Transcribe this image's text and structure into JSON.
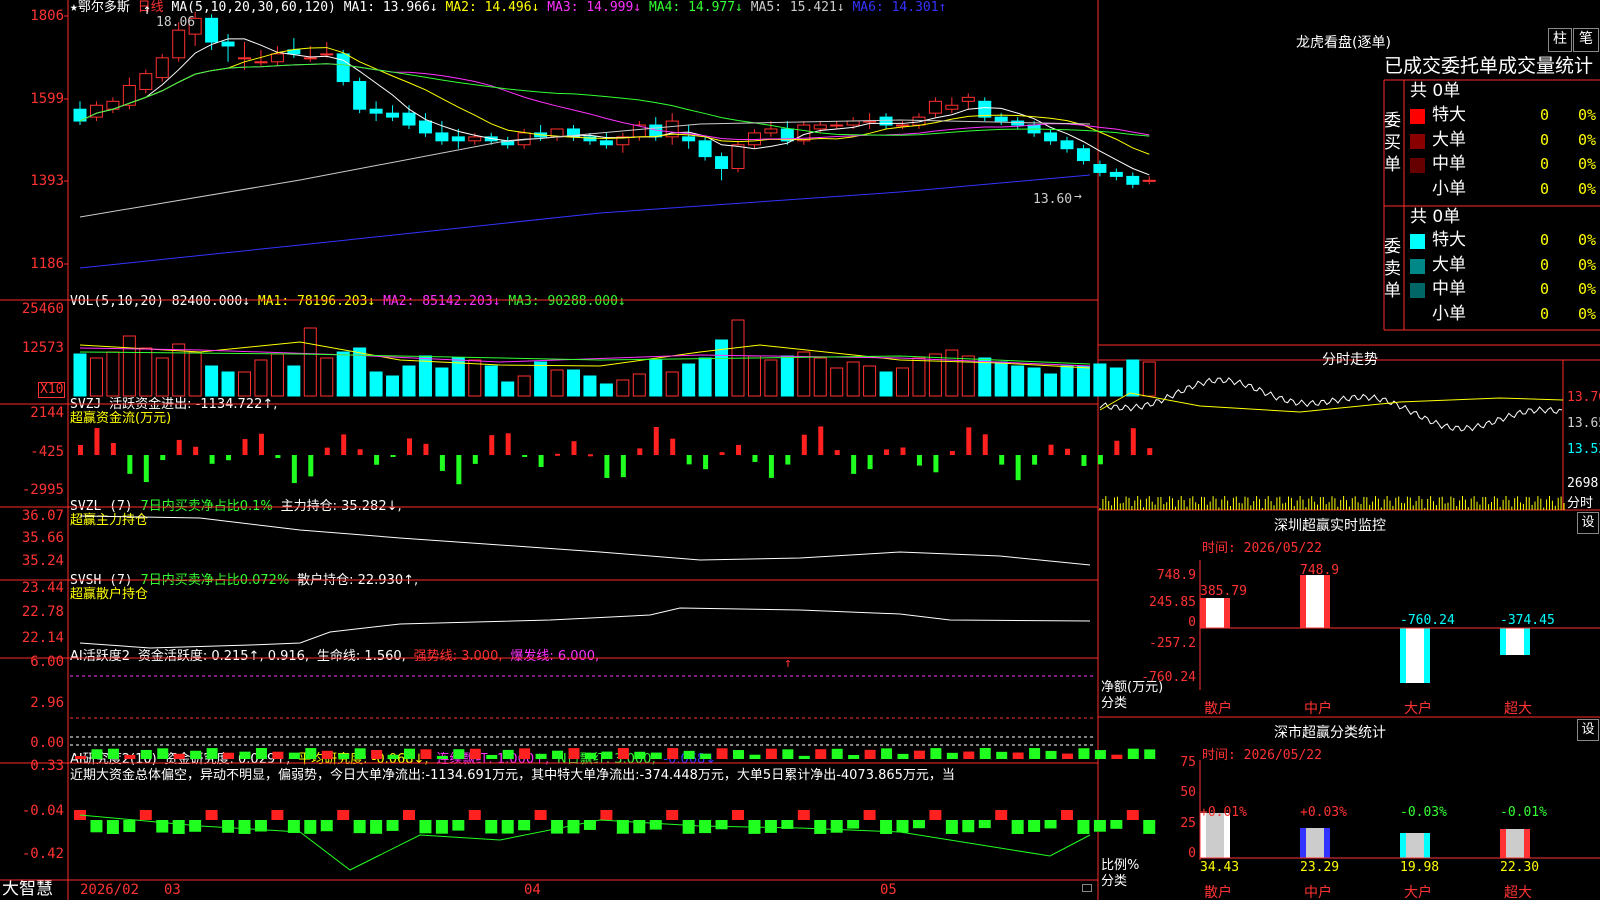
{
  "stock": {
    "name": "鄂尔多斯",
    "period": "日线",
    "star": "★"
  },
  "main": {
    "ma_label": "MA(5,10,20,30,60,120)",
    "ma": [
      {
        "label": "MA1: 13.966↓",
        "color": "#ffffff"
      },
      {
        "label": "MA2: 14.496↓",
        "color": "#ffff00"
      },
      {
        "label": "MA3: 14.999↓",
        "color": "#ff33ff"
      },
      {
        "label": "MA4: 14.977↓",
        "color": "#33ff33"
      },
      {
        "label": "MA5: 15.421↓",
        "color": "#cccccc"
      },
      {
        "label": "MA6: 14.301↑",
        "color": "#3333ff"
      }
    ],
    "ticks": [
      "1806",
      "1599",
      "1393",
      "1186"
    ],
    "high_label": "18.06",
    "low_label": "13.60"
  },
  "vol": {
    "title": "VOL(5,10,20)",
    "values": [
      {
        "label": "82400.000↓",
        "color": "#ffffff"
      },
      {
        "label": "MA1: 78196.203↓",
        "color": "#ffff00"
      },
      {
        "label": "MA2: 85142.203↓",
        "color": "#ff33ff"
      },
      {
        "label": "MA3: 90288.000↓",
        "color": "#33ff33"
      }
    ],
    "ticks": [
      "25460",
      "12573"
    ],
    "unit": "X10"
  },
  "svzj": {
    "title": "SVZJ",
    "label": "活跃资金进出: -1134.722↑,",
    "sub": "超赢资金流(万元)",
    "ticks": [
      "2144",
      "-425",
      "-2995"
    ]
  },
  "svzl": {
    "title": "SVZL (7)",
    "label": "7日内买卖净占比0.1%",
    "label2": "主力持仓: 35.282↓,",
    "sub": "超赢主力持仓",
    "ticks": [
      "36.07",
      "35.66",
      "35.24"
    ]
  },
  "svsh": {
    "title": "SVSH (7)",
    "label": "7日内买卖净占比0.072%",
    "label2": "散户持仓: 22.930↑,",
    "sub": "超赢散户持仓",
    "ticks": [
      "23.44",
      "22.78",
      "22.14"
    ]
  },
  "ai1": {
    "title": "AI活跃度2",
    "l1": "资金活跃度: 0.215↑, 0.916,",
    "l2": "生命线: 1.560,",
    "l3": "强势线: 3.000,",
    "l4": "爆发线: 6.000,",
    "ticks": [
      "6.00",
      "2.96",
      "0.00"
    ]
  },
  "ai2": {
    "title": "AI研究度2(10)",
    "l1": "资金研究度: 0.029↑,",
    "l2": "平均研究度: -0.068↓,",
    "l3": "连续飘红: 1.000↑,",
    "l4": "N日飘红: 3.000,",
    "l5": "-0.068↓",
    "text": "近期大资金总体偏空，异动不明显，偏弱势，今日大单净流出:-1134.691万元，其中特大单净流出:-374.448万元，大单5日累计净出-4073.865万元，当",
    "ticks": [
      "0.33",
      "-0.04",
      "-0.42"
    ]
  },
  "bottom": {
    "brand": "大智慧",
    "date": "2026/02",
    "m1": "03",
    "m2": "04",
    "m3": "05"
  },
  "right": {
    "dragon_title": "龙虎看盘(逐单)",
    "btn_zhu": "柱",
    "btn_bi": "笔",
    "order_title": "已成交委托单成交量统计",
    "buy": {
      "label": "委买单",
      "total": "共 0单",
      "rows": [
        {
          "name": "特大",
          "v": "0",
          "p": "0%",
          "color": "#ff0000"
        },
        {
          "name": "大单",
          "v": "0",
          "p": "0%",
          "color": "#880000"
        },
        {
          "name": "中单",
          "v": "0",
          "p": "0%",
          "color": "#660000"
        },
        {
          "name": "小单",
          "v": "0",
          "p": "0%",
          "color": "#000000"
        }
      ]
    },
    "sell": {
      "label": "委卖单",
      "total": "共 0单",
      "rows": [
        {
          "name": "特大",
          "v": "0",
          "p": "0%",
          "color": "#00ffff"
        },
        {
          "name": "大单",
          "v": "0",
          "p": "0%",
          "color": "#008888"
        },
        {
          "name": "中单",
          "v": "0",
          "p": "0%",
          "color": "#006666"
        },
        {
          "name": "小单",
          "v": "0",
          "p": "0%",
          "color": "#000000"
        }
      ]
    },
    "intraday": {
      "title": "分时走势",
      "p1": "13.76",
      "p2": "13.65",
      "p3": "13.53",
      "vol": "2698",
      "vol_unit": "分时"
    },
    "monitor": {
      "title": "深圳超赢实时监控",
      "btn": "设",
      "time": "时间: 2026/05/22",
      "ticks": [
        "748.9",
        "245.85",
        "0",
        "-257.2",
        "-760.24"
      ],
      "ylabel": "净额(万元)",
      "xlabel": "分类",
      "cats": [
        "散户",
        "中户",
        "大户",
        "超大"
      ],
      "values": [
        "385.79",
        "748.9",
        "-760.24",
        "-374.45"
      ]
    },
    "stats": {
      "title": "深市超赢分类统计",
      "btn": "设",
      "time": "时间: 2026/05/22",
      "ticks": [
        "75",
        "50",
        "25",
        "0"
      ],
      "ylabel": "比例%",
      "xlabel": "分类",
      "cats": [
        "散户",
        "中户",
        "大户",
        "超大"
      ],
      "pct": [
        "+0.01%",
        "+0.03%",
        "-0.03%",
        "-0.01%"
      ],
      "values": [
        "34.43",
        "23.29",
        "19.98",
        "22.30"
      ]
    }
  },
  "chart_data": {
    "type": "candlestick",
    "title": "鄂尔多斯 日线",
    "ylim": [
      11.86,
      18.06
    ],
    "ohlc": [
      [
        15.6,
        15.8,
        15.2,
        15.3
      ],
      [
        15.4,
        15.8,
        15.3,
        15.7
      ],
      [
        15.6,
        15.9,
        15.5,
        15.8
      ],
      [
        15.7,
        16.4,
        15.6,
        16.2
      ],
      [
        16.1,
        16.6,
        16.0,
        16.5
      ],
      [
        16.4,
        17.0,
        16.3,
        16.9
      ],
      [
        16.9,
        17.8,
        16.8,
        17.6
      ],
      [
        17.5,
        18.06,
        17.2,
        17.9
      ],
      [
        17.9,
        18.0,
        17.1,
        17.3
      ],
      [
        17.3,
        17.5,
        16.8,
        17.2
      ],
      [
        16.9,
        17.3,
        16.6,
        16.9
      ],
      [
        16.8,
        17.1,
        16.7,
        16.8
      ],
      [
        16.8,
        17.2,
        16.7,
        17.0
      ],
      [
        17.1,
        17.4,
        16.9,
        17.0
      ],
      [
        16.9,
        17.2,
        16.8,
        16.9
      ],
      [
        17.0,
        17.3,
        16.9,
        17.0
      ],
      [
        17.0,
        17.1,
        16.2,
        16.3
      ],
      [
        16.3,
        16.4,
        15.5,
        15.6
      ],
      [
        15.6,
        15.8,
        15.3,
        15.5
      ],
      [
        15.5,
        15.7,
        15.3,
        15.4
      ],
      [
        15.5,
        15.7,
        15.1,
        15.2
      ],
      [
        15.3,
        15.5,
        14.9,
        15.0
      ],
      [
        15.0,
        15.3,
        14.7,
        14.8
      ],
      [
        14.9,
        15.1,
        14.6,
        14.8
      ],
      [
        14.8,
        15.0,
        14.7,
        14.9
      ],
      [
        14.9,
        15.0,
        14.7,
        14.8
      ],
      [
        14.8,
        14.9,
        14.6,
        14.7
      ],
      [
        14.7,
        15.1,
        14.6,
        15.0
      ],
      [
        15.0,
        15.2,
        14.8,
        14.9
      ],
      [
        14.9,
        15.1,
        14.8,
        15.1
      ],
      [
        15.1,
        15.2,
        14.8,
        14.9
      ],
      [
        14.9,
        15.0,
        14.7,
        14.8
      ],
      [
        14.8,
        15.0,
        14.6,
        14.7
      ],
      [
        14.7,
        15.0,
        14.5,
        14.9
      ],
      [
        14.9,
        15.3,
        14.8,
        15.2
      ],
      [
        15.2,
        15.4,
        14.8,
        14.9
      ],
      [
        14.9,
        15.5,
        14.7,
        15.3
      ],
      [
        14.9,
        15.2,
        14.6,
        14.8
      ],
      [
        14.8,
        14.9,
        14.3,
        14.4
      ],
      [
        14.4,
        14.5,
        13.8,
        14.1
      ],
      [
        14.1,
        14.8,
        14.0,
        14.7
      ],
      [
        14.7,
        15.1,
        14.6,
        15.0
      ],
      [
        15.0,
        15.3,
        14.9,
        15.1
      ],
      [
        15.1,
        15.3,
        14.7,
        14.8
      ],
      [
        14.8,
        15.3,
        14.7,
        15.2
      ],
      [
        15.1,
        15.3,
        15.0,
        15.2
      ],
      [
        15.2,
        15.3,
        15.1,
        15.2
      ],
      [
        15.2,
        15.4,
        15.1,
        15.3
      ],
      [
        15.3,
        15.5,
        15.1,
        15.3
      ],
      [
        15.4,
        15.5,
        15.1,
        15.2
      ],
      [
        15.2,
        15.3,
        15.1,
        15.2
      ],
      [
        15.2,
        15.5,
        15.1,
        15.4
      ],
      [
        15.5,
        15.9,
        15.4,
        15.8
      ],
      [
        15.6,
        15.9,
        15.5,
        15.7
      ],
      [
        15.8,
        16.0,
        15.6,
        15.9
      ],
      [
        15.8,
        15.9,
        15.3,
        15.4
      ],
      [
        15.4,
        15.5,
        15.2,
        15.3
      ],
      [
        15.3,
        15.4,
        15.1,
        15.2
      ],
      [
        15.2,
        15.3,
        14.9,
        15.0
      ],
      [
        15.0,
        15.1,
        14.7,
        14.8
      ],
      [
        14.8,
        14.9,
        14.5,
        14.6
      ],
      [
        14.6,
        14.7,
        14.2,
        14.3
      ],
      [
        14.2,
        14.3,
        13.9,
        14.0
      ],
      [
        14.0,
        14.1,
        13.8,
        13.9
      ],
      [
        13.9,
        14.0,
        13.6,
        13.7
      ],
      [
        13.8,
        13.9,
        13.7,
        13.8
      ]
    ]
  }
}
